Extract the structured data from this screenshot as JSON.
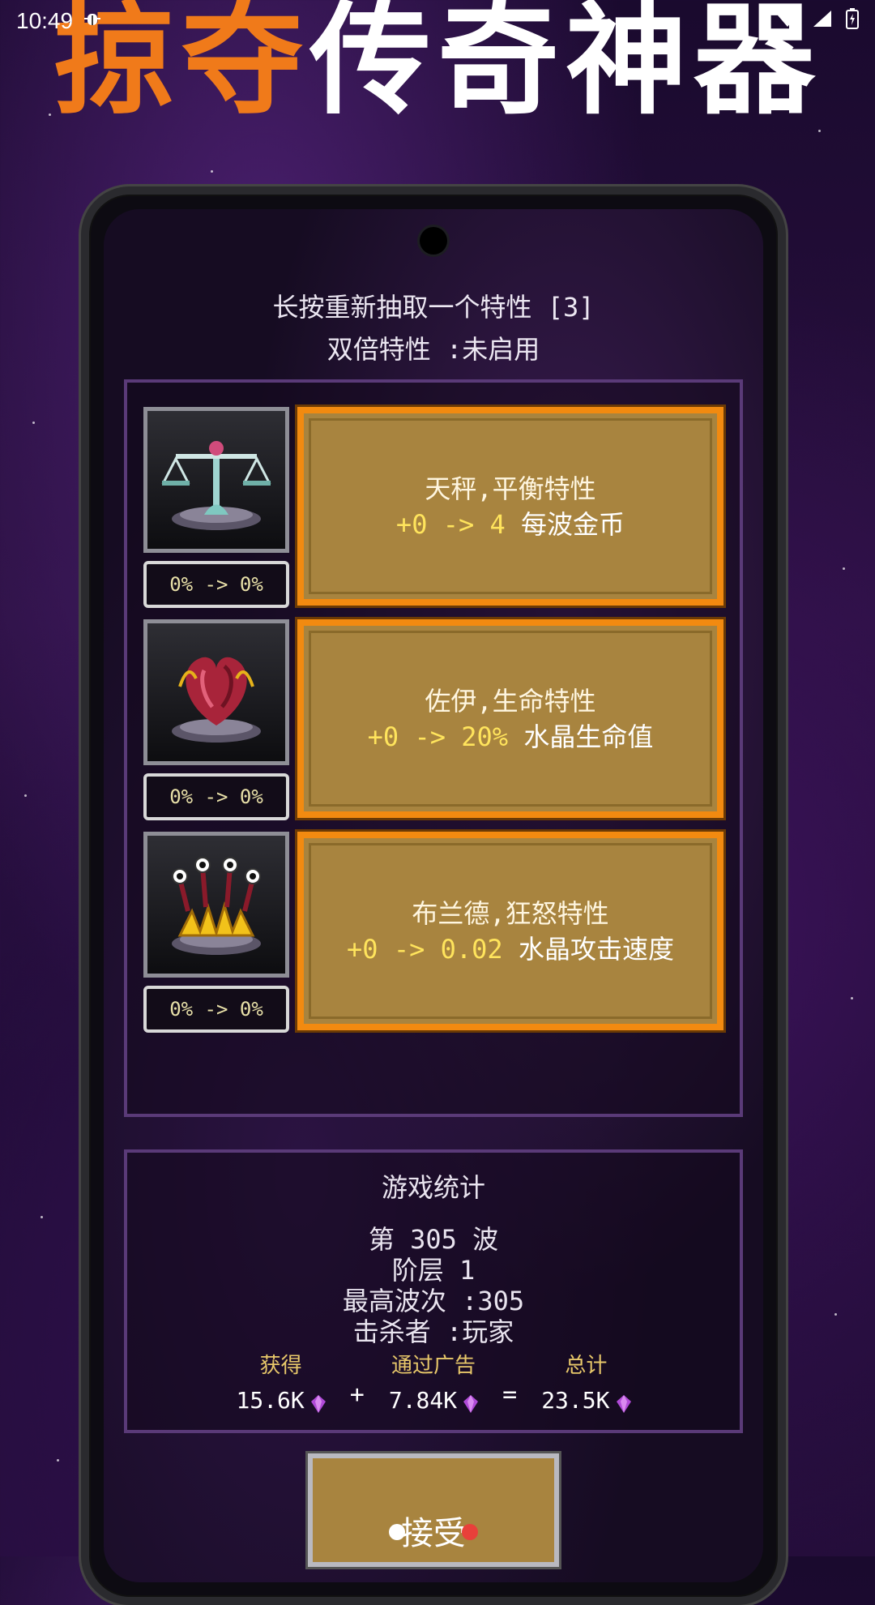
{
  "status_bar": {
    "time": "10:49"
  },
  "headline": {
    "orange": "掠夺",
    "white": "传奇神器"
  },
  "header": {
    "reroll_hint": "长按重新抽取一个特性 [3]",
    "double_trait": "双倍特性 :未启用"
  },
  "traits": [
    {
      "name": "天秤,平衡特性",
      "from": "+0 -> 4",
      "stat": "每波金币",
      "pct": "0% -> 0%",
      "icon": "balance-scale-icon"
    },
    {
      "name": "佐伊,生命特性",
      "from": "+0 -> 20%",
      "stat": "水晶生命值",
      "pct": "0% -> 0%",
      "icon": "heart-icon"
    },
    {
      "name": "布兰德,狂怒特性",
      "from": "+0 -> 0.02",
      "stat": "水晶攻击速度",
      "pct": "0% -> 0%",
      "icon": "crystal-eyes-icon"
    }
  ],
  "stats": {
    "title": "游戏统计",
    "wave": "第 305 波",
    "tier": "阶层 1",
    "best_wave": "最高波次 :305",
    "killer": "击杀者 :玩家",
    "earned_label": "获得",
    "ads_label": "通过广告",
    "total_label": "总计",
    "earned": "15.6K",
    "ads": "7.84K",
    "total": "23.5K",
    "plus": "+",
    "equals": "="
  },
  "accept_label": "接受",
  "colors": {
    "accent": "#f07a1a",
    "card": "#a8843f",
    "highlight": "#ffe45c"
  }
}
